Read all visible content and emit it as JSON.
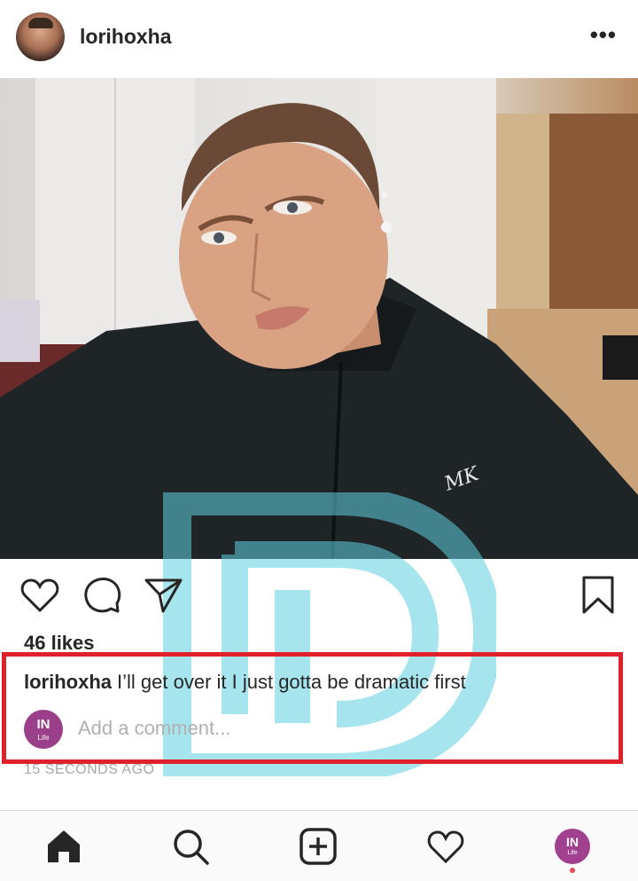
{
  "post": {
    "username": "lorihoxha",
    "more_label": "•••",
    "likes": "46 likes",
    "caption_user": "lorihoxha",
    "caption_text": "I’ll get over it I just gotta be dramatic first",
    "comment_placeholder": "Add a comment...",
    "timestamp": "15 SECONDS AGO",
    "photo_logo_text": "MK"
  },
  "actions": {
    "icons": [
      "heart-icon",
      "comment-icon",
      "share-icon",
      "bookmark-icon"
    ]
  },
  "viewer_avatar": {
    "text": "IN",
    "subtext": "Life"
  },
  "bottom_nav": {
    "items": [
      "home-icon",
      "search-icon",
      "new-post-icon",
      "activity-icon",
      "profile-avatar"
    ],
    "profile_text": "IN",
    "profile_subtext": "Life"
  },
  "colors": {
    "text": "#262626",
    "muted": "#a8a8a8",
    "highlight_border": "#e0202a",
    "watermark": "#5fd0e0",
    "avatar_purple": "#9c3f8b",
    "notification_dot": "#ed4956"
  }
}
